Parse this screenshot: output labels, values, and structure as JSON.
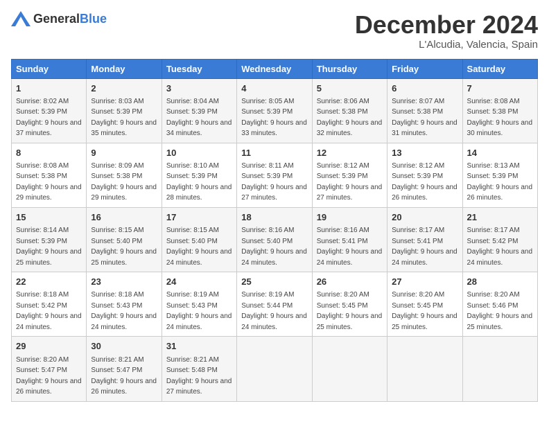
{
  "logo": {
    "general": "General",
    "blue": "Blue"
  },
  "header": {
    "title": "December 2024",
    "subtitle": "L'Alcudia, Valencia, Spain"
  },
  "columns": [
    "Sunday",
    "Monday",
    "Tuesday",
    "Wednesday",
    "Thursday",
    "Friday",
    "Saturday"
  ],
  "weeks": [
    [
      {
        "day": "1",
        "sunrise": "Sunrise: 8:02 AM",
        "sunset": "Sunset: 5:39 PM",
        "daylight": "Daylight: 9 hours and 37 minutes."
      },
      {
        "day": "2",
        "sunrise": "Sunrise: 8:03 AM",
        "sunset": "Sunset: 5:39 PM",
        "daylight": "Daylight: 9 hours and 35 minutes."
      },
      {
        "day": "3",
        "sunrise": "Sunrise: 8:04 AM",
        "sunset": "Sunset: 5:39 PM",
        "daylight": "Daylight: 9 hours and 34 minutes."
      },
      {
        "day": "4",
        "sunrise": "Sunrise: 8:05 AM",
        "sunset": "Sunset: 5:39 PM",
        "daylight": "Daylight: 9 hours and 33 minutes."
      },
      {
        "day": "5",
        "sunrise": "Sunrise: 8:06 AM",
        "sunset": "Sunset: 5:38 PM",
        "daylight": "Daylight: 9 hours and 32 minutes."
      },
      {
        "day": "6",
        "sunrise": "Sunrise: 8:07 AM",
        "sunset": "Sunset: 5:38 PM",
        "daylight": "Daylight: 9 hours and 31 minutes."
      },
      {
        "day": "7",
        "sunrise": "Sunrise: 8:08 AM",
        "sunset": "Sunset: 5:38 PM",
        "daylight": "Daylight: 9 hours and 30 minutes."
      }
    ],
    [
      {
        "day": "8",
        "sunrise": "Sunrise: 8:08 AM",
        "sunset": "Sunset: 5:38 PM",
        "daylight": "Daylight: 9 hours and 29 minutes."
      },
      {
        "day": "9",
        "sunrise": "Sunrise: 8:09 AM",
        "sunset": "Sunset: 5:38 PM",
        "daylight": "Daylight: 9 hours and 29 minutes."
      },
      {
        "day": "10",
        "sunrise": "Sunrise: 8:10 AM",
        "sunset": "Sunset: 5:39 PM",
        "daylight": "Daylight: 9 hours and 28 minutes."
      },
      {
        "day": "11",
        "sunrise": "Sunrise: 8:11 AM",
        "sunset": "Sunset: 5:39 PM",
        "daylight": "Daylight: 9 hours and 27 minutes."
      },
      {
        "day": "12",
        "sunrise": "Sunrise: 8:12 AM",
        "sunset": "Sunset: 5:39 PM",
        "daylight": "Daylight: 9 hours and 27 minutes."
      },
      {
        "day": "13",
        "sunrise": "Sunrise: 8:12 AM",
        "sunset": "Sunset: 5:39 PM",
        "daylight": "Daylight: 9 hours and 26 minutes."
      },
      {
        "day": "14",
        "sunrise": "Sunrise: 8:13 AM",
        "sunset": "Sunset: 5:39 PM",
        "daylight": "Daylight: 9 hours and 26 minutes."
      }
    ],
    [
      {
        "day": "15",
        "sunrise": "Sunrise: 8:14 AM",
        "sunset": "Sunset: 5:39 PM",
        "daylight": "Daylight: 9 hours and 25 minutes."
      },
      {
        "day": "16",
        "sunrise": "Sunrise: 8:15 AM",
        "sunset": "Sunset: 5:40 PM",
        "daylight": "Daylight: 9 hours and 25 minutes."
      },
      {
        "day": "17",
        "sunrise": "Sunrise: 8:15 AM",
        "sunset": "Sunset: 5:40 PM",
        "daylight": "Daylight: 9 hours and 24 minutes."
      },
      {
        "day": "18",
        "sunrise": "Sunrise: 8:16 AM",
        "sunset": "Sunset: 5:40 PM",
        "daylight": "Daylight: 9 hours and 24 minutes."
      },
      {
        "day": "19",
        "sunrise": "Sunrise: 8:16 AM",
        "sunset": "Sunset: 5:41 PM",
        "daylight": "Daylight: 9 hours and 24 minutes."
      },
      {
        "day": "20",
        "sunrise": "Sunrise: 8:17 AM",
        "sunset": "Sunset: 5:41 PM",
        "daylight": "Daylight: 9 hours and 24 minutes."
      },
      {
        "day": "21",
        "sunrise": "Sunrise: 8:17 AM",
        "sunset": "Sunset: 5:42 PM",
        "daylight": "Daylight: 9 hours and 24 minutes."
      }
    ],
    [
      {
        "day": "22",
        "sunrise": "Sunrise: 8:18 AM",
        "sunset": "Sunset: 5:42 PM",
        "daylight": "Daylight: 9 hours and 24 minutes."
      },
      {
        "day": "23",
        "sunrise": "Sunrise: 8:18 AM",
        "sunset": "Sunset: 5:43 PM",
        "daylight": "Daylight: 9 hours and 24 minutes."
      },
      {
        "day": "24",
        "sunrise": "Sunrise: 8:19 AM",
        "sunset": "Sunset: 5:43 PM",
        "daylight": "Daylight: 9 hours and 24 minutes."
      },
      {
        "day": "25",
        "sunrise": "Sunrise: 8:19 AM",
        "sunset": "Sunset: 5:44 PM",
        "daylight": "Daylight: 9 hours and 24 minutes."
      },
      {
        "day": "26",
        "sunrise": "Sunrise: 8:20 AM",
        "sunset": "Sunset: 5:45 PM",
        "daylight": "Daylight: 9 hours and 25 minutes."
      },
      {
        "day": "27",
        "sunrise": "Sunrise: 8:20 AM",
        "sunset": "Sunset: 5:45 PM",
        "daylight": "Daylight: 9 hours and 25 minutes."
      },
      {
        "day": "28",
        "sunrise": "Sunrise: 8:20 AM",
        "sunset": "Sunset: 5:46 PM",
        "daylight": "Daylight: 9 hours and 25 minutes."
      }
    ],
    [
      {
        "day": "29",
        "sunrise": "Sunrise: 8:20 AM",
        "sunset": "Sunset: 5:47 PM",
        "daylight": "Daylight: 9 hours and 26 minutes."
      },
      {
        "day": "30",
        "sunrise": "Sunrise: 8:21 AM",
        "sunset": "Sunset: 5:47 PM",
        "daylight": "Daylight: 9 hours and 26 minutes."
      },
      {
        "day": "31",
        "sunrise": "Sunrise: 8:21 AM",
        "sunset": "Sunset: 5:48 PM",
        "daylight": "Daylight: 9 hours and 27 minutes."
      },
      null,
      null,
      null,
      null
    ]
  ]
}
